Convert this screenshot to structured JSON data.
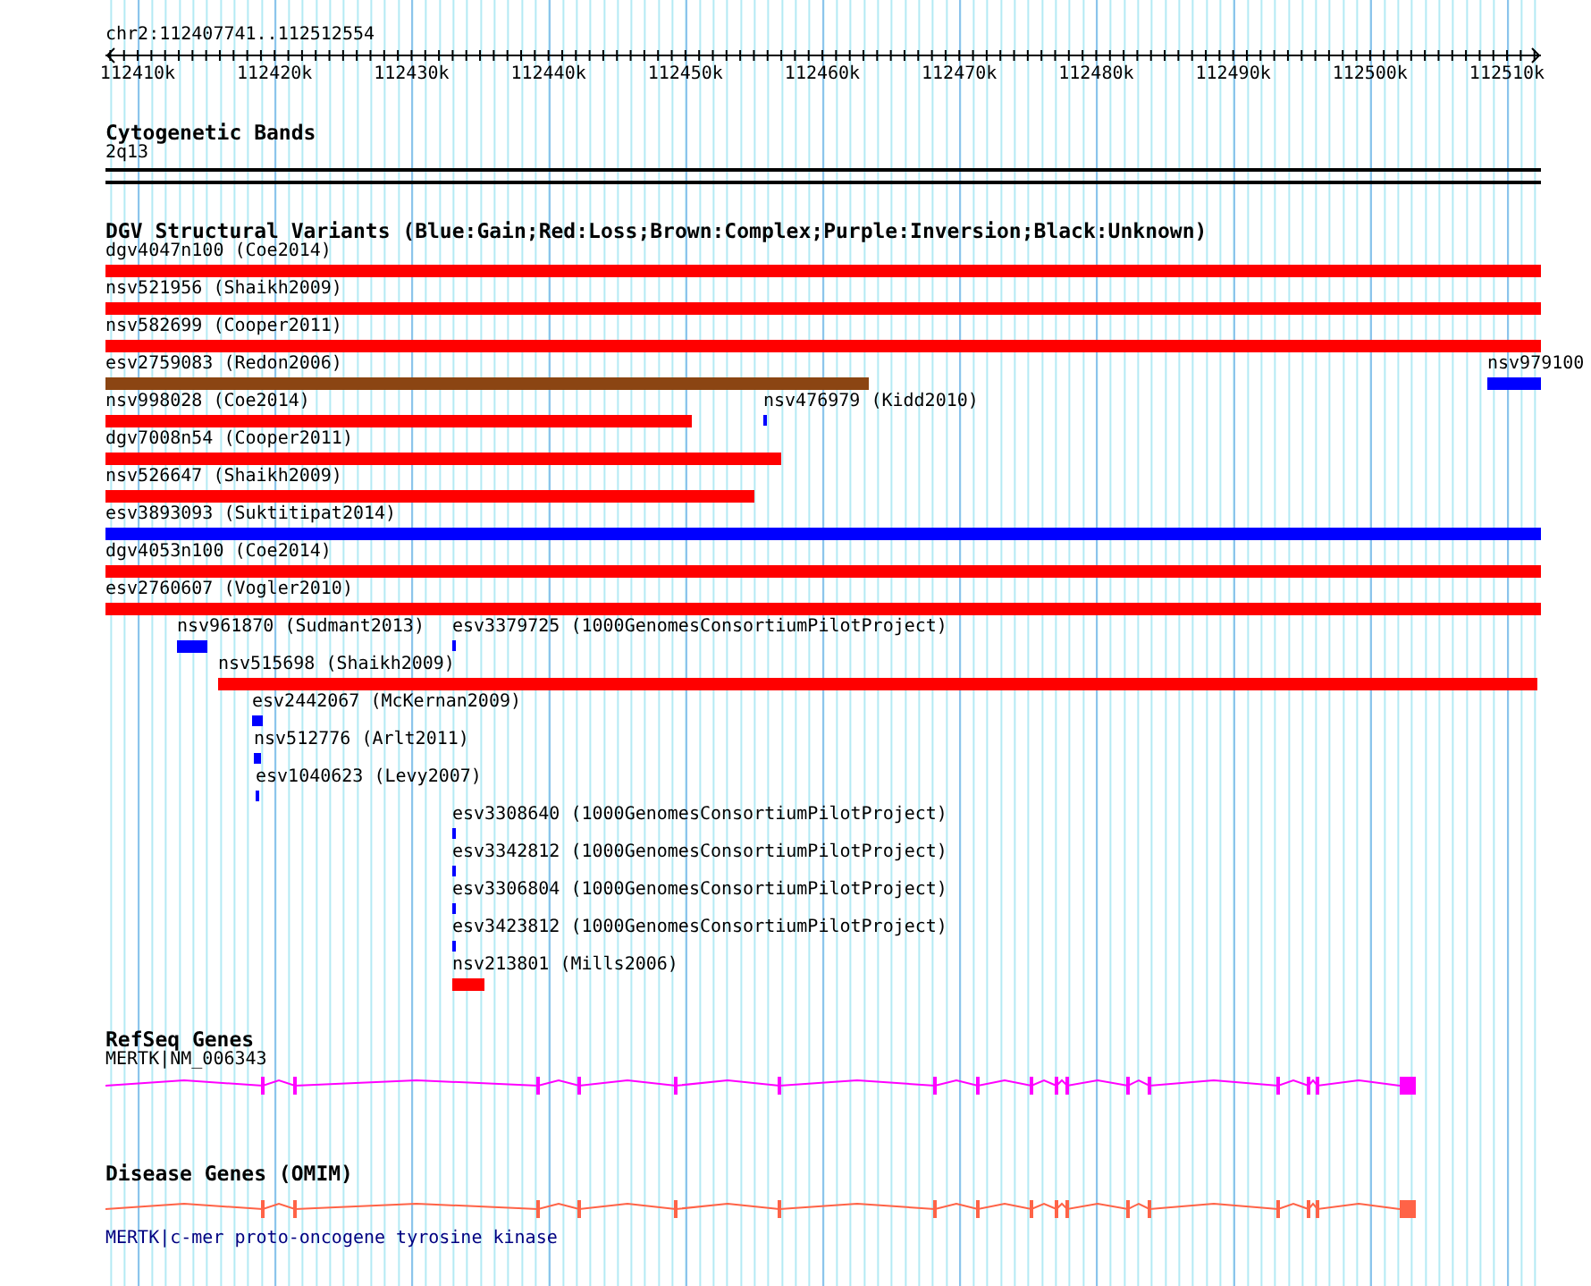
{
  "ruler": {
    "title": "chr2:112407741..112512554",
    "labels": [
      "112410k",
      "112420k",
      "112430k",
      "112440k",
      "112450k",
      "112460k",
      "112470k",
      "112480k",
      "112490k",
      "112500k",
      "112510k"
    ]
  },
  "cytogenetic_bands": {
    "title": "Cytogenetic Bands",
    "band": "2q13"
  },
  "dgv_variants": {
    "title": "DGV Structural Variants (Blue:Gain;Red:Loss;Brown:Complex;Purple:Inversion;Black:Unknown)",
    "variants": [
      {
        "label": "dgv4047n100 (Coe2014)",
        "color": "#ff0000"
      },
      {
        "label": "nsv521956 (Shaikh2009)",
        "color": "#ff0000"
      },
      {
        "label": "nsv582699 (Cooper2011)",
        "color": "#ff0000"
      },
      {
        "label": "esv2759083 (Redon2006)",
        "color": "#8b4513"
      },
      {
        "label": "nsv979100",
        "color": "#0000ff"
      },
      {
        "label": "nsv998028 (Coe2014)",
        "color": "#ff0000"
      },
      {
        "label": "nsv476979 (Kidd2010)",
        "color": "#0000ff"
      },
      {
        "label": "dgv7008n54 (Cooper2011)",
        "color": "#ff0000"
      },
      {
        "label": "nsv526647 (Shaikh2009)",
        "color": "#ff0000"
      },
      {
        "label": "esv3893093 (Suktitipat2014)",
        "color": "#0000ff"
      },
      {
        "label": "dgv4053n100 (Coe2014)",
        "color": "#ff0000"
      },
      {
        "label": "esv2760607 (Vogler2010)",
        "color": "#ff0000"
      },
      {
        "label": "nsv961870 (Sudmant2013)",
        "color": "#0000ff"
      },
      {
        "label": "esv3379725 (1000GenomesConsortiumPilotProject)",
        "color": "#0000ff"
      },
      {
        "label": "nsv515698 (Shaikh2009)",
        "color": "#ff0000"
      },
      {
        "label": "esv2442067 (McKernan2009)",
        "color": "#0000ff"
      },
      {
        "label": "nsv512776 (Arlt2011)",
        "color": "#0000ff"
      },
      {
        "label": "esv1040623 (Levy2007)",
        "color": "#0000ff"
      },
      {
        "label": "esv3308640 (1000GenomesConsortiumPilotProject)",
        "color": "#0000ff"
      },
      {
        "label": "esv3342812 (1000GenomesConsortiumPilotProject)",
        "color": "#0000ff"
      },
      {
        "label": "esv3306804 (1000GenomesConsortiumPilotProject)",
        "color": "#0000ff"
      },
      {
        "label": "esv3423812 (1000GenomesConsortiumPilotProject)",
        "color": "#0000ff"
      },
      {
        "label": "nsv213801 (Mills2006)",
        "color": "#ff0000"
      }
    ]
  },
  "refseq_genes": {
    "title": "RefSeq Genes",
    "gene": {
      "label": "MERTK|NM_006343",
      "color": "#ff00ff"
    }
  },
  "disease_genes": {
    "title": "Disease Genes (OMIM)",
    "gene": {
      "label": "MERTK|c-mer proto-oncogene tyrosine kinase",
      "color": "#ff6347"
    }
  }
}
